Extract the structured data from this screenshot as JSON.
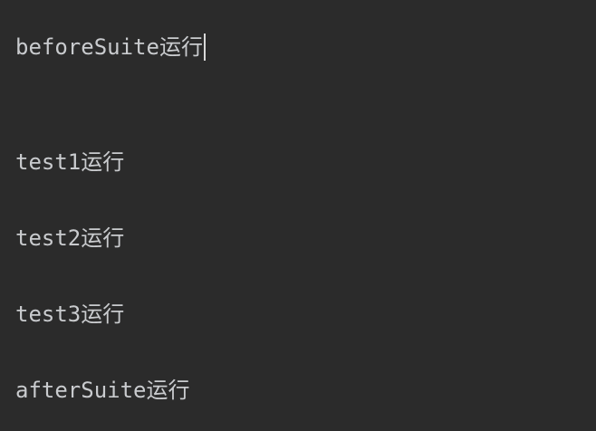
{
  "console": {
    "lines": [
      "beforeSuite运行",
      "test1运行",
      "test2运行",
      "test3运行",
      "afterSuite运行"
    ]
  },
  "colors": {
    "background": "#2b2b2b",
    "text": "#c9cbce",
    "caret": "#d8d8d8"
  }
}
